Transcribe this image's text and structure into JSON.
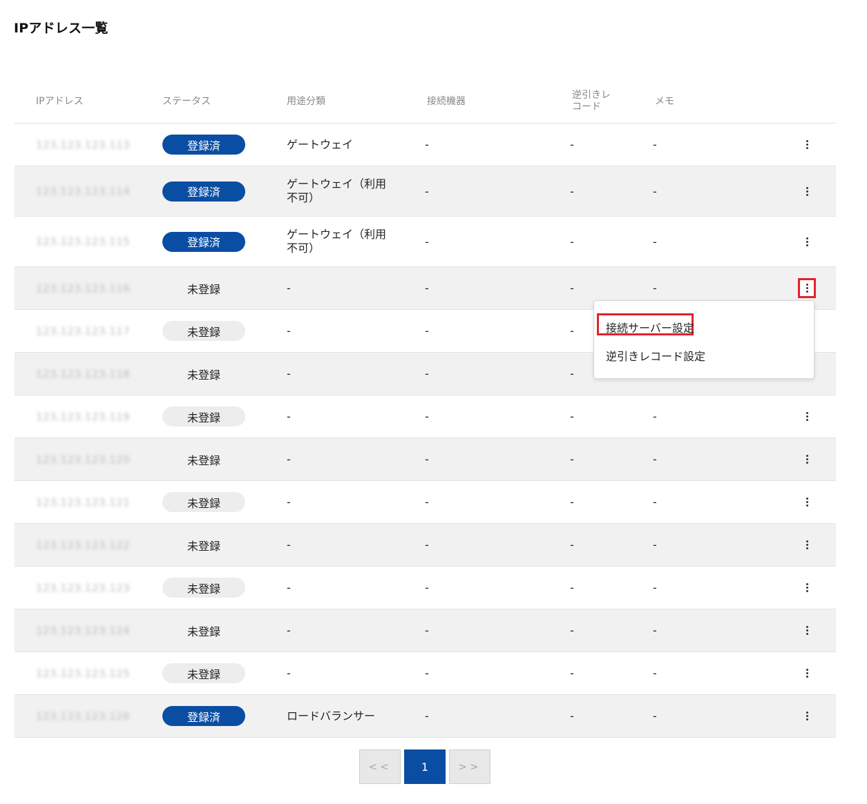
{
  "page_title": "IPアドレス一覧",
  "columns": {
    "ip": "IPアドレス",
    "status": "ステータス",
    "usage": "用途分類",
    "device": "接続機器",
    "reverse_1": "逆引きレ",
    "reverse_2": "コード",
    "memo": "メモ"
  },
  "rows": [
    {
      "ip": "123.123.123.113",
      "status": "登録済",
      "usage_1": "ゲートウェイ",
      "usage_2": "",
      "device": "-",
      "reverse": "-",
      "memo": "-"
    },
    {
      "ip": "123.123.123.114",
      "status": "登録済",
      "usage_1": "ゲートウェイ（利用",
      "usage_2": "不可）",
      "device": "-",
      "reverse": "-",
      "memo": "-"
    },
    {
      "ip": "123.123.123.115",
      "status": "登録済",
      "usage_1": "ゲートウェイ（利用",
      "usage_2": "不可）",
      "device": "-",
      "reverse": "-",
      "memo": "-"
    },
    {
      "ip": "123.123.123.116",
      "status": "未登録",
      "usage_1": "-",
      "usage_2": "",
      "device": "-",
      "reverse": "-",
      "memo": "-"
    },
    {
      "ip": "123.123.123.117",
      "status": "未登録",
      "usage_1": "-",
      "usage_2": "",
      "device": "-",
      "reverse": "-",
      "memo": ""
    },
    {
      "ip": "123.123.123.118",
      "status": "未登録",
      "usage_1": "-",
      "usage_2": "",
      "device": "-",
      "reverse": "-",
      "memo": ""
    },
    {
      "ip": "123.123.123.119",
      "status": "未登録",
      "usage_1": "-",
      "usage_2": "",
      "device": "-",
      "reverse": "-",
      "memo": "-"
    },
    {
      "ip": "123.123.123.120",
      "status": "未登録",
      "usage_1": "-",
      "usage_2": "",
      "device": "-",
      "reverse": "-",
      "memo": "-"
    },
    {
      "ip": "123.123.123.121",
      "status": "未登録",
      "usage_1": "-",
      "usage_2": "",
      "device": "-",
      "reverse": "-",
      "memo": "-"
    },
    {
      "ip": "123.123.123.122",
      "status": "未登録",
      "usage_1": "-",
      "usage_2": "",
      "device": "-",
      "reverse": "-",
      "memo": "-"
    },
    {
      "ip": "123.123.123.123",
      "status": "未登録",
      "usage_1": "-",
      "usage_2": "",
      "device": "-",
      "reverse": "-",
      "memo": "-"
    },
    {
      "ip": "123.123.123.124",
      "status": "未登録",
      "usage_1": "-",
      "usage_2": "",
      "device": "-",
      "reverse": "-",
      "memo": "-"
    },
    {
      "ip": "123.123.123.125",
      "status": "未登録",
      "usage_1": "-",
      "usage_2": "",
      "device": "-",
      "reverse": "-",
      "memo": "-"
    },
    {
      "ip": "123.123.123.126",
      "status": "登録済",
      "usage_1": "ロードバランサー",
      "usage_2": "",
      "device": "-",
      "reverse": "-",
      "memo": "-"
    }
  ],
  "dropdown": {
    "items": [
      "接続サーバー設定",
      "逆引きレコード設定"
    ]
  },
  "pagination": {
    "prev": "<<",
    "current": "1",
    "next": ">>"
  },
  "colors": {
    "accent": "#0a4ea3",
    "highlight": "#e3222b"
  },
  "icons": {
    "row_menu": "kebab-menu-icon"
  }
}
